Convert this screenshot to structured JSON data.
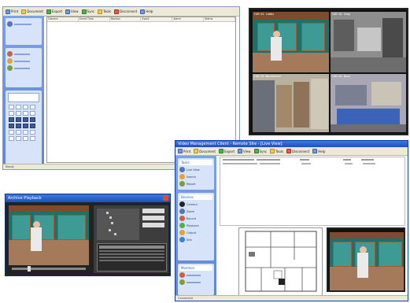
{
  "win1": {
    "toolbar": [
      "Print",
      "Document",
      "Export",
      "View",
      "Sync",
      "Tools",
      "Disconnect",
      "Help"
    ],
    "columns": [
      "Camera",
      "Event Time",
      "Monitor",
      "Event",
      "Alarm",
      "Status"
    ],
    "status": "Ready"
  },
  "quad": {
    "labels": [
      "CAM 01  Lobby",
      "CAM 02  Shop",
      "CAM 03  Warehouse",
      "CAM 04  Dock"
    ]
  },
  "player": {
    "title": "Archive Playback",
    "controls": [
      "Play",
      "Stop",
      "Go"
    ]
  },
  "win3": {
    "title": "Video Management Client - Remote Site - [Live View]",
    "toolbar": [
      "Print",
      "Document",
      "Export",
      "View",
      "Sync",
      "Tools",
      "Disconnect",
      "Help"
    ],
    "panel_headers": [
      "Tasks",
      "Devices",
      "Monitors"
    ],
    "side_items": [
      "Live View",
      "Search",
      "Report",
      "Camera",
      "Zoom",
      "Record",
      "Playback",
      "Output",
      "Site"
    ],
    "status": "Connected"
  },
  "colors": {
    "xp_blue": "#1d4fc4",
    "side_blue": "#6b93dd"
  },
  "icons": [
    "print-icon",
    "document-icon",
    "export-icon",
    "view-icon",
    "sync-icon",
    "tools-icon",
    "disconnect-icon",
    "help-icon"
  ]
}
